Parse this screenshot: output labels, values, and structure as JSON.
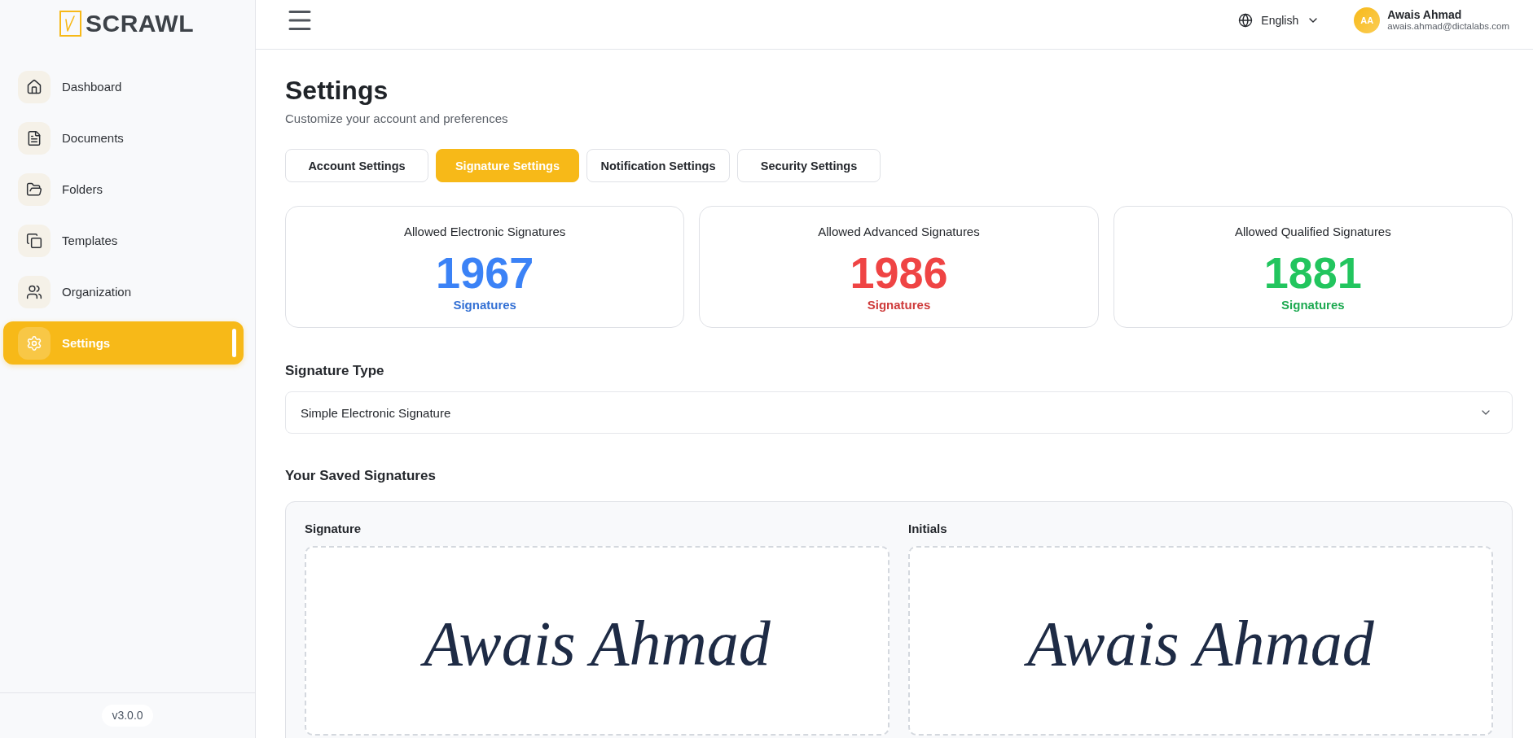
{
  "sidebar": {
    "logo": {
      "text": "SCRAWL"
    },
    "items": [
      {
        "label": "Dashboard",
        "selected": false
      },
      {
        "label": "Documents",
        "selected": false
      },
      {
        "label": "Folders",
        "selected": false
      },
      {
        "label": "Templates",
        "selected": false
      },
      {
        "label": "Organization",
        "selected": false
      },
      {
        "label": "Settings",
        "selected": true
      }
    ],
    "version": "v3.0.0"
  },
  "header": {
    "language": "English",
    "user": {
      "initials": "AA",
      "name": "Awais Ahmad",
      "email": "awais.ahmad@dictalabs.com"
    }
  },
  "page": {
    "title": "Settings",
    "subtitle": "Customize your account and preferences"
  },
  "tabs": [
    {
      "label": "Account Settings",
      "selected": false
    },
    {
      "label": "Signature Settings",
      "selected": true
    },
    {
      "label": "Notification Settings",
      "selected": false
    },
    {
      "label": "Security Settings",
      "selected": false
    }
  ],
  "stats": [
    {
      "title": "Allowed Electronic Signatures",
      "value": "1967",
      "unit": "Signatures",
      "color": "#3b82f6"
    },
    {
      "title": "Allowed Advanced Signatures",
      "value": "1986",
      "unit": "Signatures",
      "color": "#ef4444"
    },
    {
      "title": "Allowed Qualified Signatures",
      "value": "1881",
      "unit": "Signatures",
      "color": "#22c55e"
    }
  ],
  "signature_type": {
    "label": "Signature Type",
    "value": "Simple Electronic Signature"
  },
  "saved_signatures": {
    "title": "Your Saved Signatures",
    "items": [
      {
        "label": "Signature",
        "signature": "Awais Ahmad"
      },
      {
        "label": "Initials",
        "signature": "Awais Ahmad"
      }
    ]
  }
}
